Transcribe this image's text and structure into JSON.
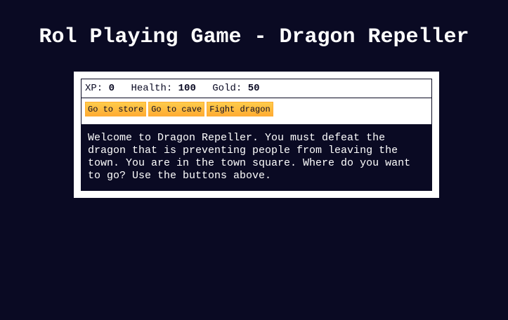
{
  "title": "Rol Playing Game - Dragon Repeller",
  "stats": {
    "xp_label": "XP:",
    "xp_value": "0",
    "health_label": "Health:",
    "health_value": "100",
    "gold_label": "Gold:",
    "gold_value": "50"
  },
  "controls": {
    "store_label": "Go to store",
    "cave_label": "Go to cave",
    "fight_label": "Fight dragon"
  },
  "message": "Welcome to Dragon Repeller. You must defeat the dragon that is preventing people from leaving the town. You are in the town square. Where do you want to go? Use the buttons above.",
  "colors": {
    "background": "#0a0a23",
    "panel": "#ffffff",
    "button": "#feac32"
  }
}
